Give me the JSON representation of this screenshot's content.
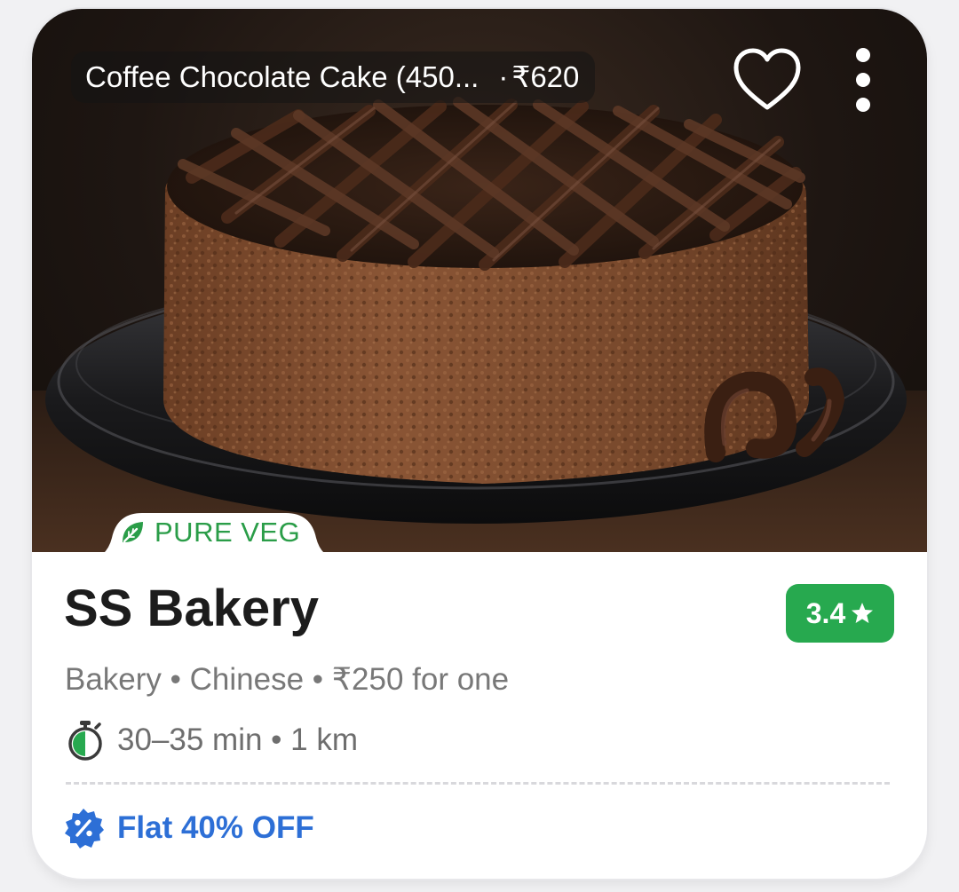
{
  "colors": {
    "veg_green": "#2a9d48",
    "rating_green": "#27a94f",
    "offer_blue": "#2d6fd6",
    "meta_gray": "#787878"
  },
  "hero": {
    "item_title": "Coffee Chocolate Cake (450...",
    "separator": "·",
    "item_price": "₹620",
    "image_subject": "chocolate-cake-photo"
  },
  "badge": {
    "veg_label": "PURE VEG",
    "icon": "leaf-icon"
  },
  "restaurant": {
    "name": "SS Bakery",
    "rating": "3.4",
    "rating_icon": "star-icon",
    "meta": "Bakery • Chinese • ₹250 for one",
    "eta": "30–35 min • 1 km",
    "eta_icon": "timer-icon"
  },
  "offer": {
    "label": "Flat 40% OFF",
    "icon": "discount-badge-icon"
  },
  "actions": {
    "favorite_icon": "heart-icon",
    "more_icon": "more-vertical-icon"
  }
}
